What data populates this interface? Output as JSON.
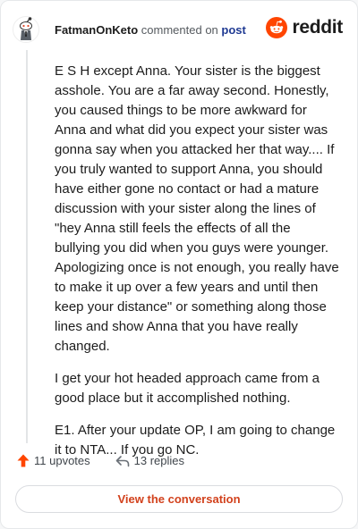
{
  "header": {
    "author": "FatmanOnKeto",
    "action_text": "commented on",
    "target_link": "post",
    "brand": "reddit",
    "brand_color": "#ff4500"
  },
  "comment": {
    "paragraphs": [
      "E S H except Anna. Your sister is the biggest asshole. You are a far away second. Honestly, you caused things to be more awkward for Anna and what did you expect your sister was gonna say when you attacked her that way.... If you truly wanted to support Anna, you should have either gone no contact or had a mature discussion with your sister along the lines of \"hey Anna still feels the effects of all the bullying you did when you guys were younger. Apologizing once is not enough, you really have to make it up over a few years and until then keep your distance\" or something along those lines and show Anna that you have really changed.",
      "I get your hot headed approach came from a good place but it accomplished nothing.",
      "E1. After your update OP, I am going to change it to NTA... If you go NC."
    ]
  },
  "footer": {
    "upvotes": "11 upvotes",
    "replies": "13 replies",
    "view_button": "View the conversation"
  },
  "icons": {
    "avatar": "snoo-avatar-icon",
    "logo": "reddit-logo-icon",
    "upvote": "upvote-arrow-icon",
    "reply": "reply-arrow-icon"
  }
}
